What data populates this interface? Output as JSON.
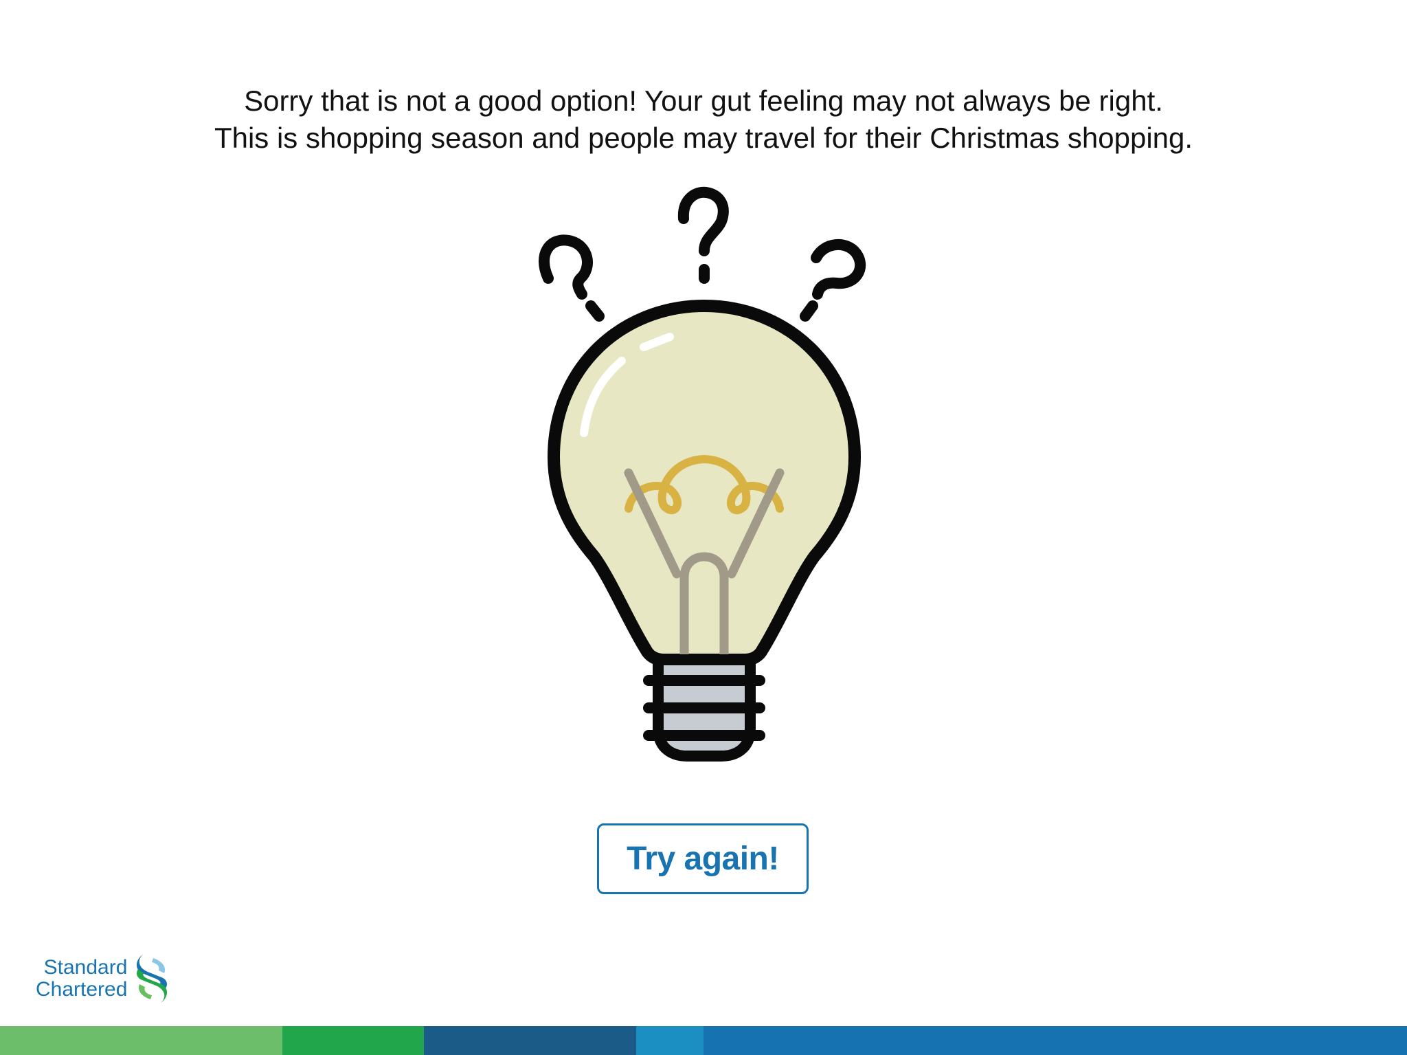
{
  "message": {
    "line1": "Sorry that is not a good option! Your gut feeling may not always be right.",
    "line2": "This is shopping season and people may travel for their Christmas shopping."
  },
  "illustration": {
    "icon": "lightbulb-question-icon",
    "colors": {
      "outline": "#0a0a0a",
      "glass": "#e8e7c4",
      "filament": "#d9b244",
      "wire": "#a19a88",
      "base": "#c7cbd2",
      "highlight": "#ffffff"
    }
  },
  "button": {
    "label": "Try again!",
    "color": "#1874b1"
  },
  "brand": {
    "line1": "Standard",
    "line2": "Chartered",
    "icon": "standard-chartered-logo-icon",
    "colors": [
      "#1874b1",
      "#6cbe63",
      "#22a74a",
      "#8cc6e6"
    ]
  },
  "bottom_bar": {
    "colors": [
      "#6cbe6a",
      "#22a64c",
      "#1a5b87",
      "#1b8fc1",
      "#1672b0"
    ]
  }
}
